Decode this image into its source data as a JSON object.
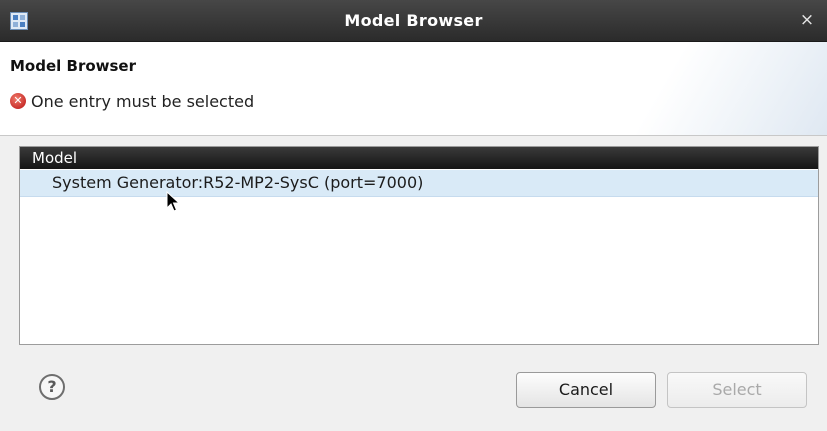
{
  "window": {
    "title": "Model Browser",
    "close_glyph": "×"
  },
  "header": {
    "title": "Model Browser",
    "error_icon": "error-icon",
    "error_message": "One entry must be selected"
  },
  "table": {
    "column_header": "Model",
    "rows": [
      {
        "label": "System Generator:R52-MP2-SysC (port=7000)",
        "selected": true
      }
    ]
  },
  "footer": {
    "help_glyph": "?",
    "cancel_label": "Cancel",
    "select_label": "Select",
    "select_enabled": false
  },
  "colors": {
    "titlebar": "#2b2b2b",
    "selected_row": "#d9eaf7",
    "error": "#c9302c"
  }
}
